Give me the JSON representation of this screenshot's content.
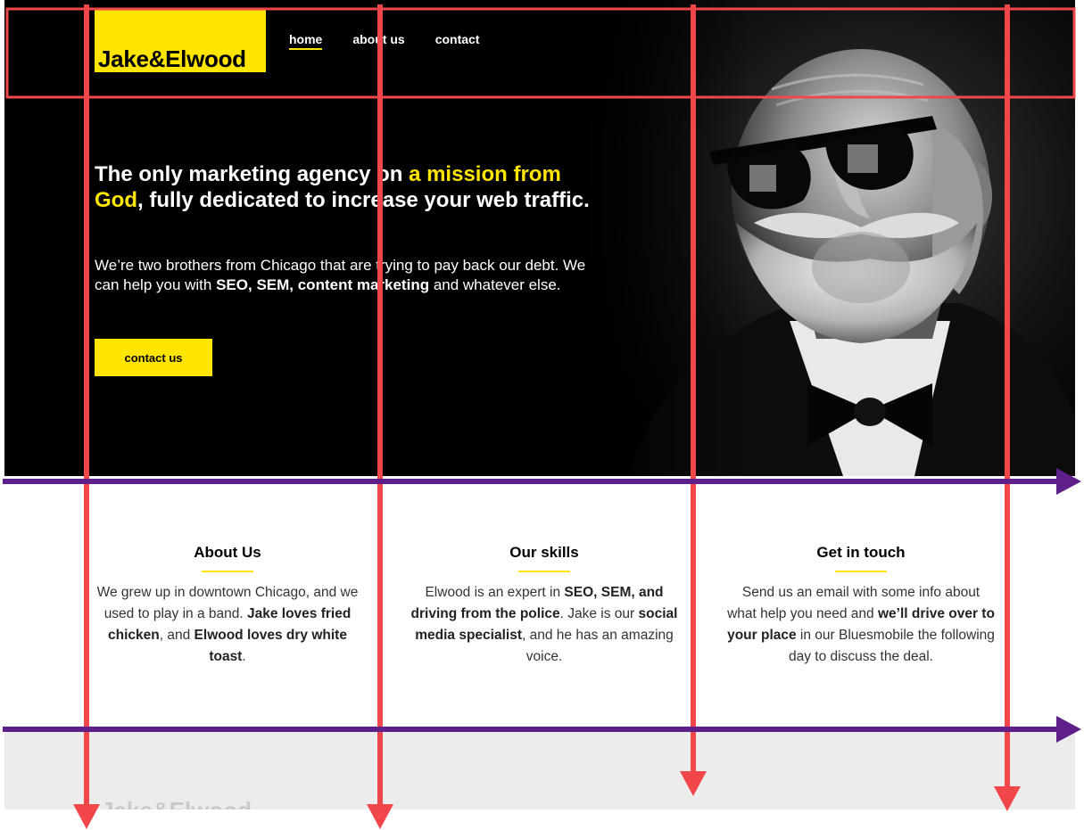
{
  "header": {
    "logo_text": "Jake&Elwood",
    "nav": [
      {
        "label": "home",
        "active": true
      },
      {
        "label": "about us",
        "active": false
      },
      {
        "label": "contact",
        "active": false
      }
    ]
  },
  "hero": {
    "headline_part1": "The only marketing agency on ",
    "headline_accent": "a mission from God",
    "headline_part2": ", fully dedicated to increase your web traffic.",
    "lead_part1": "We’re two brothers from Chicago that are trying to pay back our debt. We can help you with ",
    "lead_bold": "SEO, SEM, content marketing",
    "lead_part2": " and whatever else.",
    "cta_label": "contact us",
    "image_alt": "portrait of a bearded man with sunglasses and bow tie"
  },
  "features": [
    {
      "title": "About Us",
      "p1": "We grew up in downtown Chicago, and we used to play in a band. ",
      "b1": "Jake loves fried chicken",
      "p2": ", and ",
      "b2": "Elwood loves dry white toast",
      "p3": "."
    },
    {
      "title": "Our skills",
      "p1": "Elwood is an expert in ",
      "b1": "SEO, SEM, and driving from the police",
      "p2": ". Jake is our ",
      "b2": "social media specialist",
      "p3": ", and he has an amazing voice."
    },
    {
      "title": "Get in touch",
      "p1": "Send us an email with some info about what help you need and ",
      "b1": "we’ll drive over to your place",
      "p2": " in our Bluesmobile the following day to discuss the deal.",
      "b2": "",
      "p3": ""
    }
  ],
  "footer": {
    "logo_text": "Jake&Elwood"
  },
  "colors": {
    "brand_yellow": "#ffe500",
    "annotation_red": "#f2474a",
    "annotation_purple": "#5e1f8a"
  }
}
